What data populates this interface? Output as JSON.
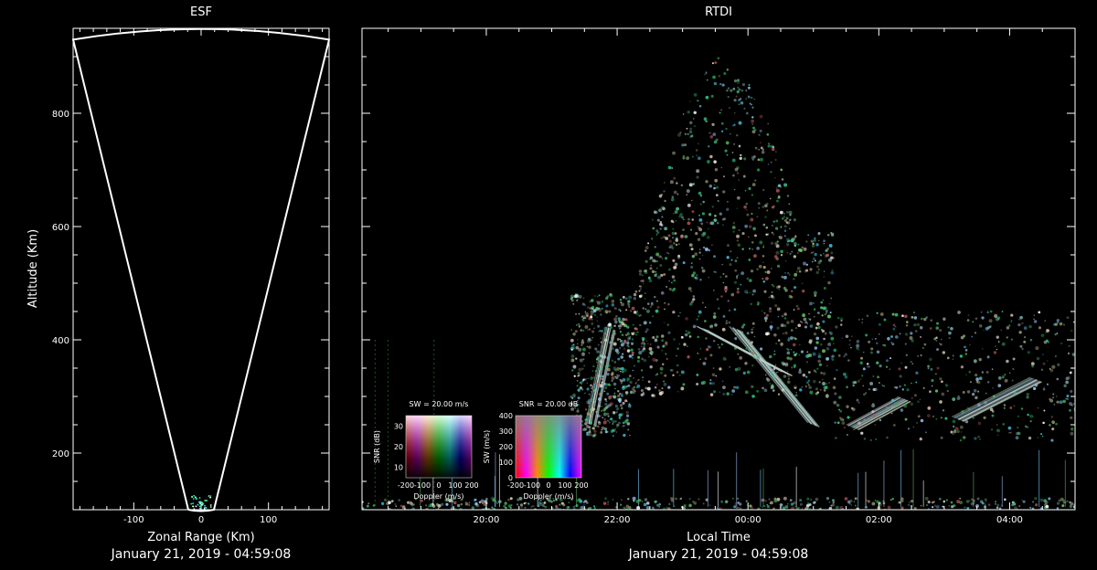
{
  "chart_data": [
    {
      "type": "scatter",
      "title": "ESF",
      "xlabel": "Zonal Range (Km)",
      "ylabel": "Altitude (Km)",
      "xlim": [
        -190,
        190
      ],
      "ylim": [
        100,
        950
      ],
      "x_ticks": [
        -100,
        0,
        100
      ],
      "y_ticks": [
        200,
        400,
        600,
        800
      ],
      "timestamp": "January 21, 2019 - 04:59:08",
      "beam_edges": {
        "left": [
          [
            -19,
            100
          ],
          [
            -190,
            930
          ]
        ],
        "right": [
          [
            19,
            100
          ],
          [
            190,
            930
          ]
        ]
      },
      "arc_altitude_center": 950
    },
    {
      "type": "heatmap",
      "title": "RTDI",
      "xlabel": "Local Time",
      "ylabel": "",
      "xlim_hours": [
        18.1,
        29.0
      ],
      "ylim": [
        100,
        950
      ],
      "x_tick_labels": [
        "20:00",
        "22:00",
        "00:00",
        "02:00",
        "04:00"
      ],
      "x_tick_hours": [
        20,
        22,
        24,
        26,
        28
      ],
      "timestamp": "January 21, 2019 - 04:59:08",
      "echo_regions": [
        {
          "t_start": 21.3,
          "t_end": 22.2,
          "alt_low": 230,
          "alt_high": 480
        },
        {
          "t_start": 22.2,
          "t_end": 25.3,
          "alt_low": 300,
          "alt_high": 900
        },
        {
          "t_start": 25.3,
          "t_end": 29.0,
          "alt_low": 220,
          "alt_high": 450
        },
        {
          "t_start": 18.1,
          "t_end": 29.0,
          "alt_low": 100,
          "alt_high": 120
        }
      ]
    }
  ],
  "legends": [
    {
      "title": "SW = 20.00 m/s",
      "xlabel": "Doppler (m/s)",
      "ylabel": "SNR (dB)",
      "x_ticks": [
        "-200",
        "-100",
        "0",
        "100",
        "200"
      ],
      "y_ticks": [
        "10",
        "20",
        "30"
      ]
    },
    {
      "title": "SNR = 20.00 dB",
      "xlabel": "Doppler (m/s)",
      "ylabel": "SW (m/s)",
      "x_ticks": [
        "-200",
        "-100",
        "0",
        "100",
        "200"
      ],
      "y_ticks": [
        "0",
        "100",
        "200",
        "300",
        "400"
      ]
    }
  ]
}
